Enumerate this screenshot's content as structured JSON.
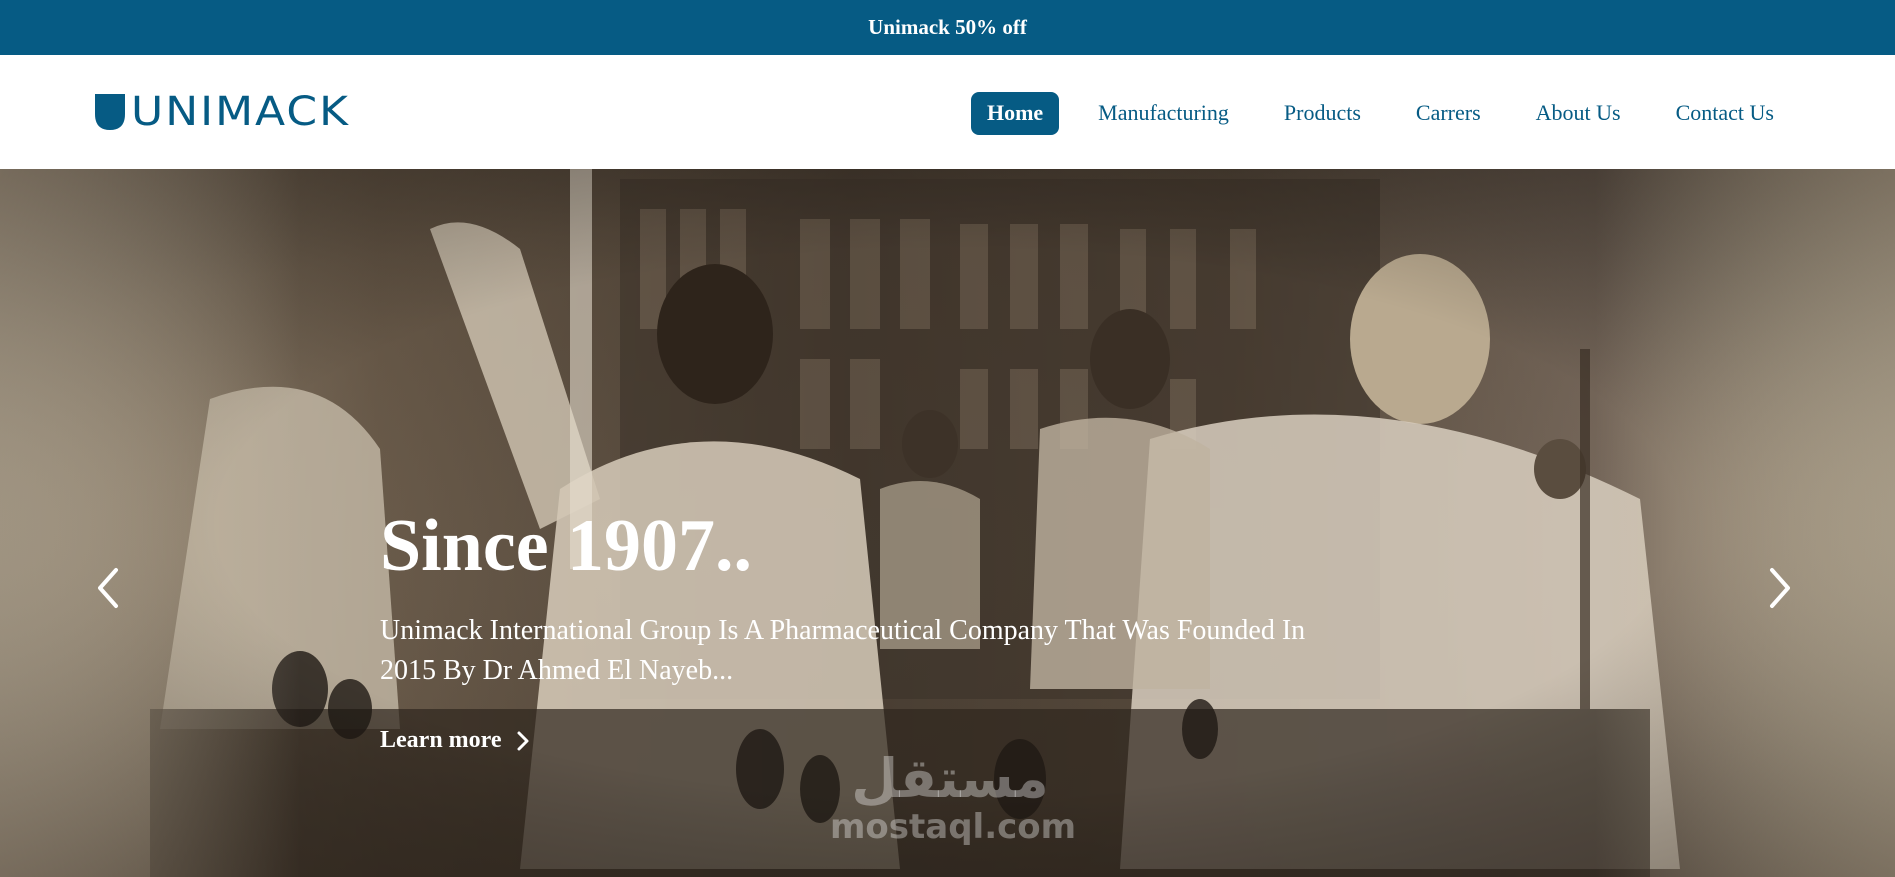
{
  "promo": {
    "text": "Unimack 50% off"
  },
  "header": {
    "logo_text": "UNIMACK",
    "nav": [
      {
        "label": "Home",
        "active": true
      },
      {
        "label": "Manufacturing",
        "active": false
      },
      {
        "label": "Products",
        "active": false
      },
      {
        "label": "Carrers",
        "active": false
      },
      {
        "label": "About Us",
        "active": false
      },
      {
        "label": "Contact Us",
        "active": false
      }
    ]
  },
  "hero": {
    "title": "Since 1907..",
    "description": "Unimack International Group Is A Pharmaceutical Company That Was Founded In 2015 By Dr Ahmed El Nayeb...",
    "cta_label": "Learn more",
    "prev_icon": "chevron-left-icon",
    "next_icon": "chevron-right-icon",
    "background": "sepia photo of scientists working in a laboratory"
  },
  "watermark": {
    "arabic": "مستقل",
    "latin": "mostaql.com"
  },
  "colors": {
    "brand": "#065b84",
    "white": "#ffffff"
  }
}
